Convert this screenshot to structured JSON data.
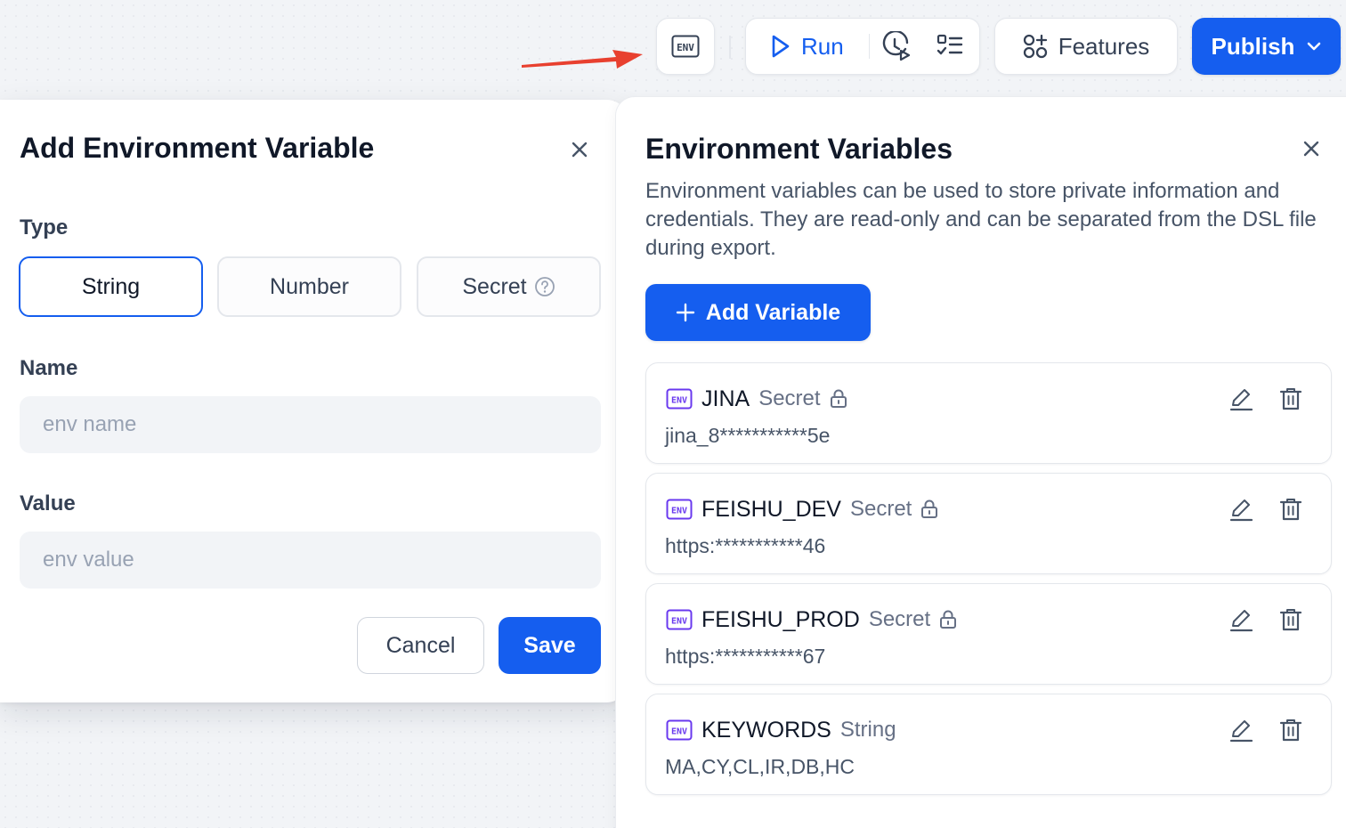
{
  "toolbar": {
    "env_icon_text": "ENV",
    "run_label": "Run",
    "features_label": "Features",
    "publish_label": "Publish"
  },
  "modal": {
    "title": "Add Environment Variable",
    "type_label": "Type",
    "type_options": [
      "String",
      "Number",
      "Secret"
    ],
    "selected_type": "String",
    "name_label": "Name",
    "name_placeholder": "env name",
    "value_label": "Value",
    "value_placeholder": "env value",
    "cancel_label": "Cancel",
    "save_label": "Save"
  },
  "panel": {
    "title": "Environment Variables",
    "description": "Environment variables can be used to store private information and credentials. They are read-only and can be separated from the DSL file during export.",
    "add_button_label": "Add Variable",
    "variables": [
      {
        "name": "JINA",
        "type": "Secret",
        "value": "jina_8***********5e",
        "locked": true
      },
      {
        "name": "FEISHU_DEV",
        "type": "Secret",
        "value": "https:***********46",
        "locked": true
      },
      {
        "name": "FEISHU_PROD",
        "type": "Secret",
        "value": "https:***********67",
        "locked": true
      },
      {
        "name": "KEYWORDS",
        "type": "String",
        "value": "MA,CY,CL,IR,DB,HC",
        "locked": false
      }
    ]
  },
  "colors": {
    "primary": "#155eef",
    "env_badge": "#6938ef",
    "annotation_arrow": "#e8402f",
    "background": "#f2f4f7"
  },
  "icons": [
    "env-icon",
    "play-icon",
    "history-clock-icon",
    "checklist-icon",
    "features-grid-icon",
    "chevron-down-icon",
    "close-icon",
    "help-circle-icon",
    "plus-icon",
    "lock-icon",
    "edit-icon",
    "trash-icon"
  ]
}
